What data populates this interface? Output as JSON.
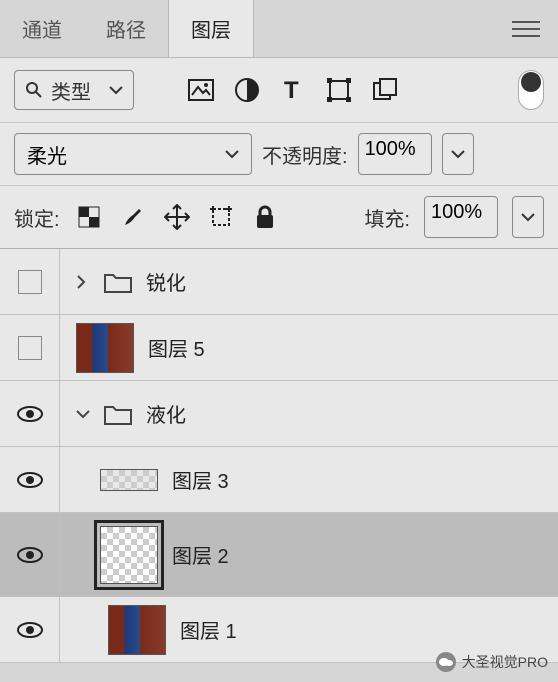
{
  "tabs": {
    "channels": "通道",
    "paths": "路径",
    "layers": "图层"
  },
  "filter": {
    "type_label": "类型"
  },
  "blend": {
    "mode": "柔光",
    "opacity_label": "不透明度:",
    "opacity_value": "100%",
    "fill_label": "填充:",
    "fill_value": "100%",
    "lock_label": "锁定:"
  },
  "layers": [
    {
      "name": "锐化",
      "kind": "group",
      "expanded": false,
      "visible": false
    },
    {
      "name": "图层 5",
      "kind": "photo",
      "visible": false
    },
    {
      "name": "液化",
      "kind": "group",
      "expanded": true,
      "visible": true
    },
    {
      "name": "图层 3",
      "kind": "checker-small",
      "visible": true
    },
    {
      "name": "图层 2",
      "kind": "checker",
      "visible": true,
      "selected": true
    },
    {
      "name": "图层 1",
      "kind": "photo",
      "visible": true
    }
  ],
  "watermark": "大圣视觉PRO"
}
